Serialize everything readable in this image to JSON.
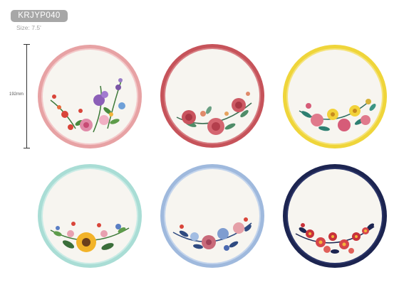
{
  "product": {
    "code": "KRJYP040",
    "size_label": "Size: 7.5'",
    "dimension_label": "192mm"
  },
  "plates": [
    {
      "name": "pink-wildflower-plate",
      "rim_color": "#e7a2a4",
      "rim_inner": "#f3c8c9"
    },
    {
      "name": "red-rose-plate",
      "rim_color": "#c6535a",
      "rim_inner": "#d77d82"
    },
    {
      "name": "yellow-bloom-plate",
      "rim_color": "#efd53a",
      "rim_inner": "#f5e37a"
    },
    {
      "name": "sunflower-plate",
      "rim_color": "#a9ddd5",
      "rim_inner": "#c9ebe5"
    },
    {
      "name": "blue-floral-plate",
      "rim_color": "#9fb9dd",
      "rim_inner": "#c3d4ec"
    },
    {
      "name": "navy-red-floral-plate",
      "rim_color": "#1c2450",
      "rim_inner": "#2b3568"
    }
  ]
}
